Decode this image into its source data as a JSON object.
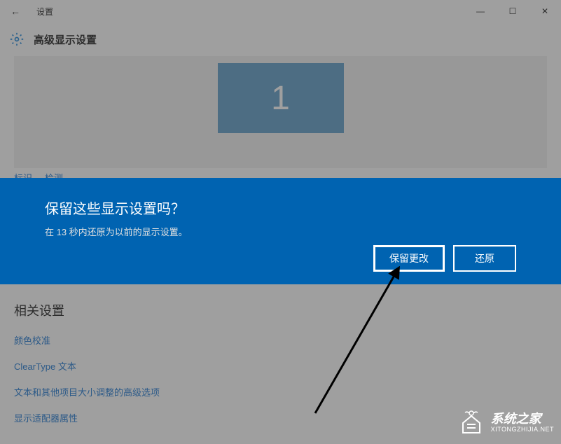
{
  "titlebar": {
    "title": "设置"
  },
  "header": {
    "page_title": "高级显示设置"
  },
  "display": {
    "monitor_number": "1",
    "identify_label": "标识",
    "detect_label": "检测"
  },
  "dialog": {
    "title": "保留这些显示设置吗？",
    "message": "在 13 秒内还原为以前的显示设置。",
    "keep_label": "保留更改",
    "revert_label": "还原"
  },
  "related": {
    "title": "相关设置",
    "links": [
      "颜色校准",
      "ClearType 文本",
      "文本和其他项目大小调整的高级选项",
      "显示适配器属性"
    ]
  },
  "watermark": {
    "cn": "系统之家",
    "en": "XITONGZHIJIA.NET"
  }
}
